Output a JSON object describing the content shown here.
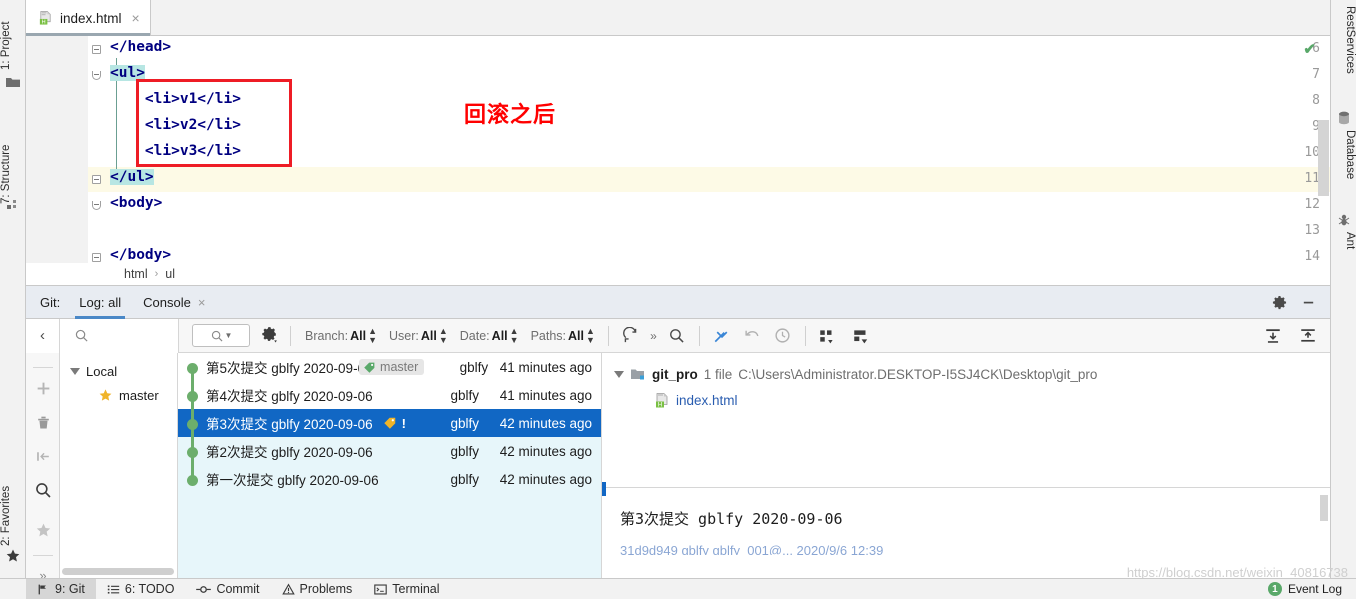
{
  "left_strip": {
    "tabs": [
      {
        "label": "1: Project",
        "underline": "1",
        "icon": "project-folder-icon"
      },
      {
        "label": "7: Structure",
        "underline": "7",
        "icon": "structure-icon"
      },
      {
        "label": "2: Favorites",
        "underline": "2",
        "icon": "star-icon"
      }
    ]
  },
  "right_strip": {
    "tabs": [
      {
        "label": "RestServices",
        "icon": "rest-services-icon"
      },
      {
        "label": "Database",
        "icon": "database-icon"
      },
      {
        "label": "Ant",
        "icon": "ant-icon"
      }
    ]
  },
  "editor": {
    "tab": {
      "title": "index.html",
      "icon": "html-file-icon",
      "close": "×"
    },
    "annotation": "回滚之后",
    "inspection_status": "✔",
    "lines": [
      {
        "no": "6",
        "code": "</head>",
        "fold": true,
        "highlight": false
      },
      {
        "no": "7",
        "code": "<ul>",
        "fold": true,
        "highlight": true
      },
      {
        "no": "8",
        "code": "    <li>v1</li>",
        "fold": false,
        "highlight": false
      },
      {
        "no": "9",
        "code": "    <li>v2</li>",
        "fold": false,
        "highlight": false
      },
      {
        "no": "10",
        "code": "    <li>v3</li>",
        "fold": false,
        "highlight": false
      },
      {
        "no": "11",
        "code": "</ul>",
        "fold": true,
        "highlight": true
      },
      {
        "no": "12",
        "code": "<body>",
        "fold": true,
        "highlight": false
      },
      {
        "no": "13",
        "code": "",
        "fold": false,
        "highlight": false
      },
      {
        "no": "14",
        "code": "</body>",
        "fold": true,
        "highlight": false
      }
    ],
    "breadcrumb": {
      "root": "html",
      "sep": "›",
      "leaf": "ul"
    }
  },
  "git_window": {
    "label": "Git:",
    "tabs": [
      {
        "label": "Log: all",
        "active": true,
        "closable": false
      },
      {
        "label": "Console",
        "active": false,
        "closable": true
      }
    ],
    "close_glyph": "×",
    "settings_icon": "gear-icon",
    "minimize_icon": "minimize-icon",
    "toolbar": {
      "collapse_icon": "chevron-left-icon",
      "search_icon": "search-icon",
      "search_placeholder": "",
      "text_filter_icon": "search-dropdown-icon",
      "gear_icon": "gear-dropdown-icon",
      "filters": [
        {
          "key": "Branch:",
          "value": "All"
        },
        {
          "key": "User:",
          "value": "All"
        },
        {
          "key": "Date:",
          "value": "All"
        },
        {
          "key": "Paths:",
          "value": "All"
        }
      ],
      "actions": [
        {
          "icon": "refresh-icon",
          "name": "refresh-button"
        },
        {
          "icon": "overflow-icon",
          "name": "more-actions-button"
        },
        {
          "icon": "search-icon",
          "name": "find-button"
        },
        {
          "icon": "cherry-pick-icon",
          "name": "cherry-pick-button"
        },
        {
          "icon": "revert-icon",
          "name": "revert-button"
        },
        {
          "icon": "reset-icon",
          "name": "reset-button"
        },
        {
          "icon": "columns-icon",
          "name": "show-columns-button"
        },
        {
          "icon": "layout-icon",
          "name": "details-layout-button"
        },
        {
          "icon": "expand-all-icon",
          "name": "expand-all-button"
        },
        {
          "icon": "collapse-all-icon",
          "name": "collapse-all-button"
        }
      ]
    },
    "branch_panel": {
      "buttons": [
        {
          "icon": "add-icon",
          "name": "add-button"
        },
        {
          "icon": "trash-icon",
          "name": "delete-button"
        },
        {
          "icon": "collapse-arrow-icon",
          "name": "collapse-button"
        },
        {
          "icon": "search-icon",
          "name": "search-button"
        },
        {
          "icon": "star-icon",
          "name": "favorite-button"
        },
        {
          "icon": "overflow-icon",
          "name": "more-button"
        }
      ],
      "tree": [
        {
          "label": "Local",
          "type": "group",
          "expanded": true
        },
        {
          "label": "master",
          "type": "branch",
          "favorite": true
        }
      ]
    },
    "commits": [
      {
        "subject": "第5次提交 gblfy 2020-09-06",
        "ref": "master",
        "ref_type": "branch",
        "author": "gblfy",
        "date": "41 minutes ago",
        "selected": false,
        "tinted": false
      },
      {
        "subject": "第4次提交 gblfy 2020-09-06",
        "ref": "",
        "ref_type": "",
        "author": "gblfy",
        "date": "41 minutes ago",
        "selected": false,
        "tinted": false
      },
      {
        "subject": "第3次提交 gblfy 2020-09-06",
        "ref": "!",
        "ref_type": "tag",
        "author": "gblfy",
        "date": "42 minutes ago",
        "selected": true,
        "tinted": false
      },
      {
        "subject": "第2次提交 gblfy 2020-09-06",
        "ref": "",
        "ref_type": "",
        "author": "gblfy",
        "date": "42 minutes ago",
        "selected": false,
        "tinted": true
      },
      {
        "subject": "第一次提交 gblfy 2020-09-06",
        "ref": "",
        "ref_type": "",
        "author": "gblfy",
        "date": "42 minutes ago",
        "selected": false,
        "tinted": true
      }
    ],
    "details": {
      "repo": {
        "name": "git_pro",
        "count": "1 file",
        "path": "C:\\Users\\Administrator.DESKTOP-I5SJ4CK\\Desktop\\git_pro",
        "icon": "repo-folder-icon"
      },
      "file": {
        "name": "index.html",
        "icon": "html-file-icon"
      },
      "commit_message": "第3次提交 gblfy 2020-09-06",
      "commit_meta": "31d9d949  gblfy  gblfy_001@...  2020/9/6  12:39"
    }
  },
  "status_bar": {
    "items": [
      {
        "label": "9: Git",
        "underline": "9",
        "icon": "git-branch-icon",
        "active": true
      },
      {
        "label": "6: TODO",
        "underline": "6",
        "icon": "todo-list-icon",
        "active": false
      },
      {
        "label": "Commit",
        "underline": "",
        "icon": "commit-icon",
        "active": false
      },
      {
        "label": "Problems",
        "underline": "",
        "icon": "warning-icon",
        "active": false
      },
      {
        "label": "Terminal",
        "underline": "",
        "icon": "terminal-icon",
        "active": false
      }
    ],
    "event_log": {
      "label": "Event Log",
      "count": "1"
    }
  },
  "watermark": "https://blog.csdn.net/weixin_40816738",
  "colors": {
    "accent_blue": "#1167c4",
    "tab_underline": "#4a88c7",
    "annotation_red": "#ff0000",
    "graph_green": "#6cae6c",
    "tag_yellow": "#f0b429",
    "tinted_row": "#e7f6fa"
  }
}
